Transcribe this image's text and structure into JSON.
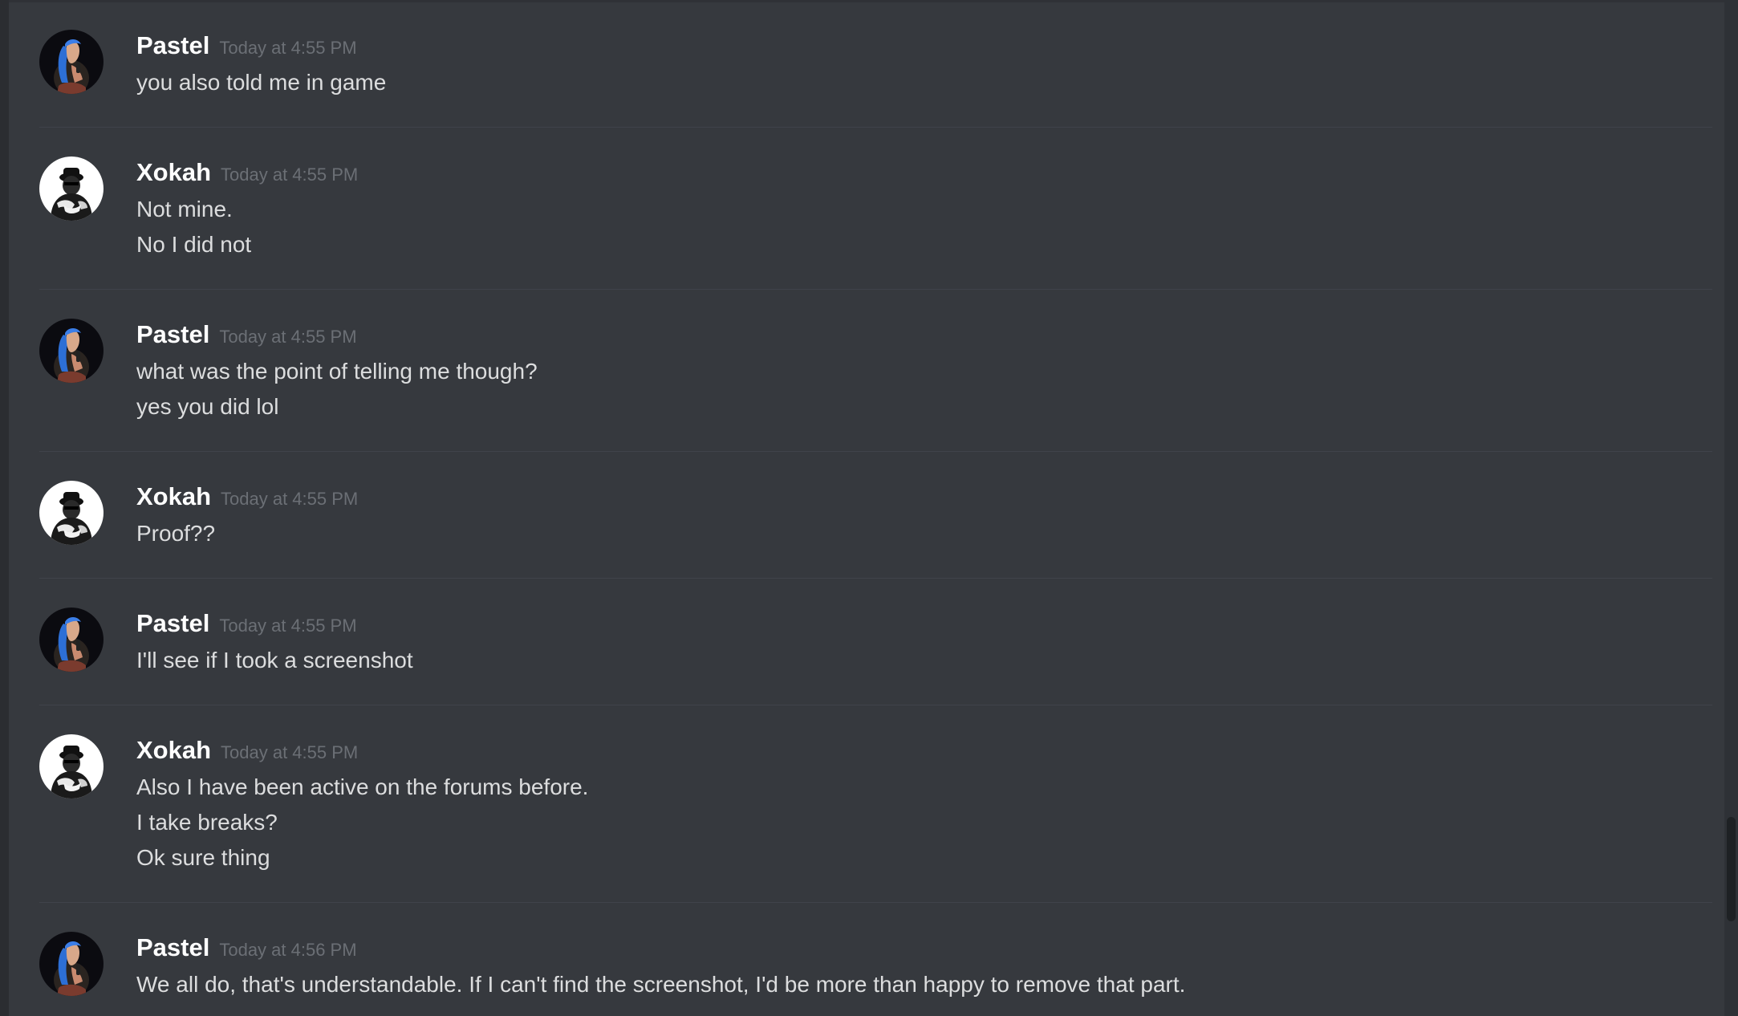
{
  "messages": [
    {
      "author": "Pastel",
      "avatar": "pastel-avatar",
      "timestamp": "Today at 4:55 PM",
      "lines": [
        "you also told me in game"
      ]
    },
    {
      "author": "Xokah",
      "avatar": "xokah-avatar",
      "timestamp": "Today at 4:55 PM",
      "lines": [
        "Not mine.",
        "No I did not"
      ]
    },
    {
      "author": "Pastel",
      "avatar": "pastel-avatar",
      "timestamp": "Today at 4:55 PM",
      "lines": [
        "what was the point of telling me though?",
        "yes you did lol"
      ]
    },
    {
      "author": "Xokah",
      "avatar": "xokah-avatar",
      "timestamp": "Today at 4:55 PM",
      "lines": [
        "Proof??"
      ]
    },
    {
      "author": "Pastel",
      "avatar": "pastel-avatar",
      "timestamp": "Today at 4:55 PM",
      "lines": [
        "I'll see if I took a screenshot"
      ]
    },
    {
      "author": "Xokah",
      "avatar": "xokah-avatar",
      "timestamp": "Today at 4:55 PM",
      "lines": [
        "Also I have been active on the forums before.",
        "I take breaks?",
        "Ok sure thing"
      ]
    },
    {
      "author": "Pastel",
      "avatar": "pastel-avatar",
      "timestamp": "Today at 4:56 PM",
      "lines": [
        "We all do, that's understandable. If I can't find the screenshot, I'd be more than happy to remove that part."
      ]
    }
  ],
  "colors": {
    "background": "#36393e",
    "author": "#ffffff",
    "timestamp": "#6b6f75",
    "message_text": "#dcddde",
    "divider": "#40434a"
  }
}
